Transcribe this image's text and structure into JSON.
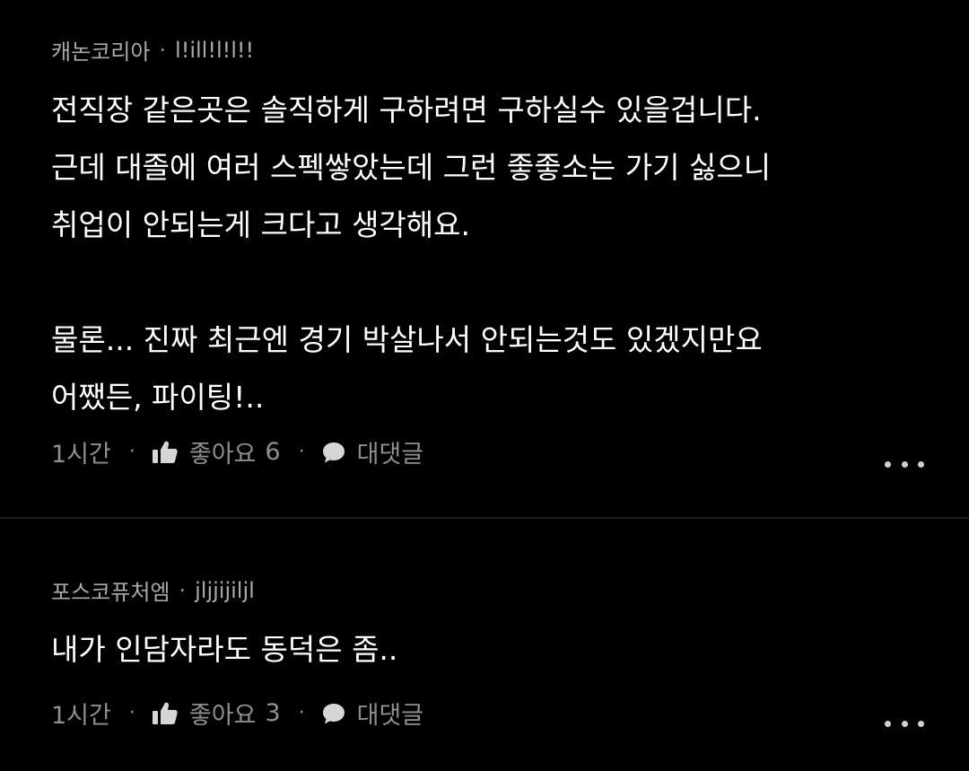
{
  "comments": [
    {
      "channel": "캐논코리아",
      "version": "l!ill!l!l!!",
      "body": "전직장 같은곳은 솔직하게 구하려면 구하실수 있을겁니다.\n근데 대졸에 여러 스펙쌓았는데 그런 좋좋소는 가기 싫으니\n취업이 안되는게 크다고 생각해요.\n\n물론... 진짜 최근엔 경기 박살나서 안되는것도 있겠지만요\n어쨌든, 파이팅!..",
      "time": "1시간",
      "like_label": "좋아요",
      "like_count": "6",
      "reply_label": "대댓글"
    },
    {
      "channel": "포스코퓨처엠",
      "version": "jljjijiljl",
      "body": "내가 인담자라도 동덕은 좀..",
      "time": "1시간",
      "like_label": "좋아요",
      "like_count": "3",
      "reply_label": "대댓글"
    }
  ],
  "separator": "·",
  "icons": {
    "like": "thumbs-up-icon",
    "reply": "speech-bubble-icon",
    "more": "more-dots-icon"
  },
  "colors": {
    "background": "#000000",
    "text": "#ffffff",
    "meta": "#a9a9a9",
    "action": "#8f8f8f",
    "divider": "#1c1c1c"
  }
}
